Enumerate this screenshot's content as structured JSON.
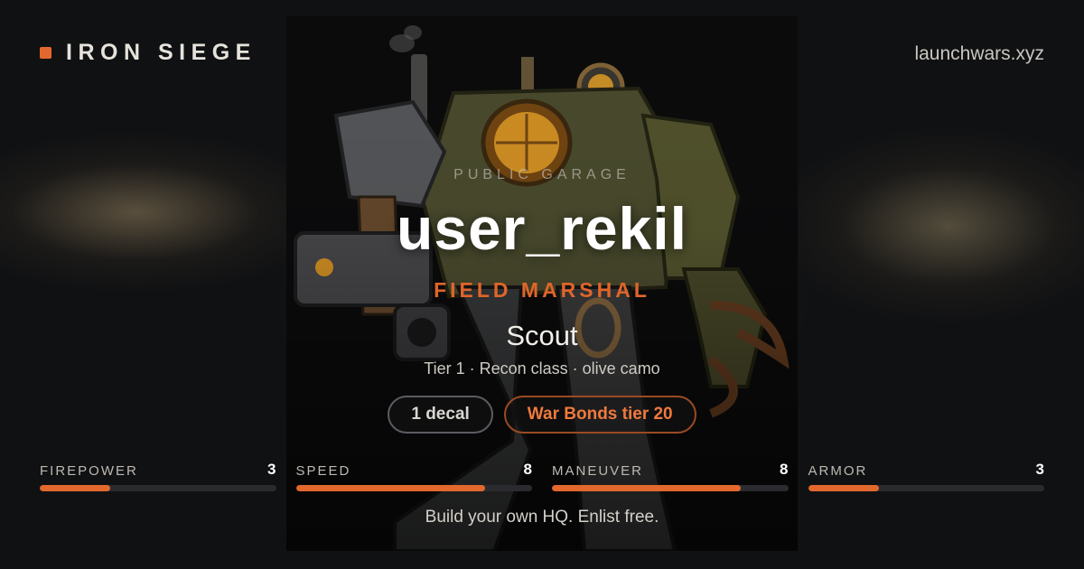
{
  "brand": {
    "name": "IRON SIEGE",
    "site": "launchwars.xyz"
  },
  "garage": {
    "label": "PUBLIC GARAGE",
    "username": "user_rekil",
    "rank": "FIELD MARSHAL"
  },
  "mech": {
    "name": "Scout",
    "description": "Tier 1 · Recon class · olive camo",
    "badges": [
      "1 decal",
      "War Bonds tier 20"
    ]
  },
  "stats": [
    {
      "label": "FIREPOWER",
      "value": "3",
      "fraction": 0.3
    },
    {
      "label": "SPEED",
      "value": "8",
      "fraction": 0.8
    },
    {
      "label": "MANEUVER",
      "value": "8",
      "fraction": 0.8
    },
    {
      "label": "ARMOR",
      "value": "3",
      "fraction": 0.3
    }
  ],
  "footer": "Build your own HQ. Enlist free.",
  "colors": {
    "accent": "#e2682e",
    "background": "#0d0e10"
  },
  "icons": {
    "brand": "square-dot-icon",
    "hero": "mech-robot-illustration"
  }
}
